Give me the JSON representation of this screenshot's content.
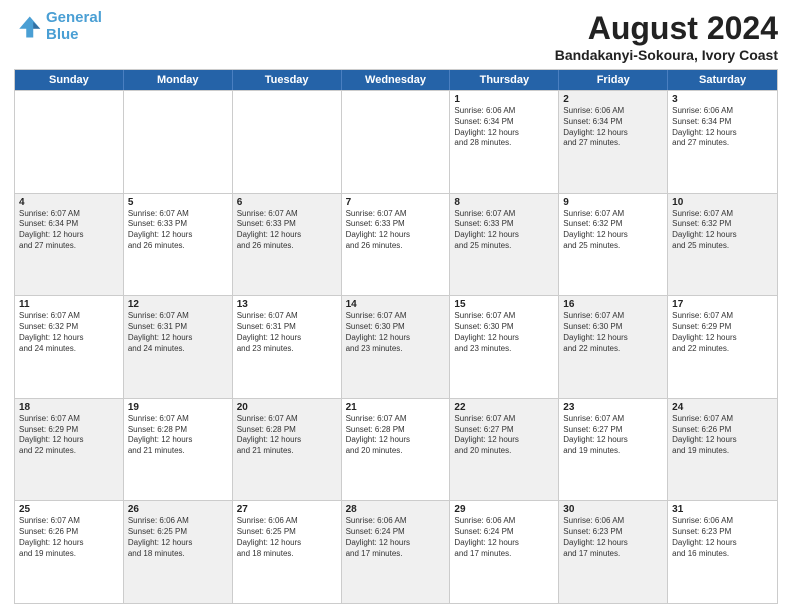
{
  "logo": {
    "line1": "General",
    "line2": "Blue"
  },
  "title": "August 2024",
  "subtitle": "Bandakanyi-Sokoura, Ivory Coast",
  "header_days": [
    "Sunday",
    "Monday",
    "Tuesday",
    "Wednesday",
    "Thursday",
    "Friday",
    "Saturday"
  ],
  "weeks": [
    [
      {
        "day": "",
        "info": "",
        "shaded": false,
        "empty": true
      },
      {
        "day": "",
        "info": "",
        "shaded": false,
        "empty": true
      },
      {
        "day": "",
        "info": "",
        "shaded": false,
        "empty": true
      },
      {
        "day": "",
        "info": "",
        "shaded": false,
        "empty": true
      },
      {
        "day": "1",
        "info": "Sunrise: 6:06 AM\nSunset: 6:34 PM\nDaylight: 12 hours\nand 28 minutes.",
        "shaded": false
      },
      {
        "day": "2",
        "info": "Sunrise: 6:06 AM\nSunset: 6:34 PM\nDaylight: 12 hours\nand 27 minutes.",
        "shaded": true
      },
      {
        "day": "3",
        "info": "Sunrise: 6:06 AM\nSunset: 6:34 PM\nDaylight: 12 hours\nand 27 minutes.",
        "shaded": false
      }
    ],
    [
      {
        "day": "4",
        "info": "Sunrise: 6:07 AM\nSunset: 6:34 PM\nDaylight: 12 hours\nand 27 minutes.",
        "shaded": true
      },
      {
        "day": "5",
        "info": "Sunrise: 6:07 AM\nSunset: 6:33 PM\nDaylight: 12 hours\nand 26 minutes.",
        "shaded": false
      },
      {
        "day": "6",
        "info": "Sunrise: 6:07 AM\nSunset: 6:33 PM\nDaylight: 12 hours\nand 26 minutes.",
        "shaded": true
      },
      {
        "day": "7",
        "info": "Sunrise: 6:07 AM\nSunset: 6:33 PM\nDaylight: 12 hours\nand 26 minutes.",
        "shaded": false
      },
      {
        "day": "8",
        "info": "Sunrise: 6:07 AM\nSunset: 6:33 PM\nDaylight: 12 hours\nand 25 minutes.",
        "shaded": true
      },
      {
        "day": "9",
        "info": "Sunrise: 6:07 AM\nSunset: 6:32 PM\nDaylight: 12 hours\nand 25 minutes.",
        "shaded": false
      },
      {
        "day": "10",
        "info": "Sunrise: 6:07 AM\nSunset: 6:32 PM\nDaylight: 12 hours\nand 25 minutes.",
        "shaded": true
      }
    ],
    [
      {
        "day": "11",
        "info": "Sunrise: 6:07 AM\nSunset: 6:32 PM\nDaylight: 12 hours\nand 24 minutes.",
        "shaded": false
      },
      {
        "day": "12",
        "info": "Sunrise: 6:07 AM\nSunset: 6:31 PM\nDaylight: 12 hours\nand 24 minutes.",
        "shaded": true
      },
      {
        "day": "13",
        "info": "Sunrise: 6:07 AM\nSunset: 6:31 PM\nDaylight: 12 hours\nand 23 minutes.",
        "shaded": false
      },
      {
        "day": "14",
        "info": "Sunrise: 6:07 AM\nSunset: 6:30 PM\nDaylight: 12 hours\nand 23 minutes.",
        "shaded": true
      },
      {
        "day": "15",
        "info": "Sunrise: 6:07 AM\nSunset: 6:30 PM\nDaylight: 12 hours\nand 23 minutes.",
        "shaded": false
      },
      {
        "day": "16",
        "info": "Sunrise: 6:07 AM\nSunset: 6:30 PM\nDaylight: 12 hours\nand 22 minutes.",
        "shaded": true
      },
      {
        "day": "17",
        "info": "Sunrise: 6:07 AM\nSunset: 6:29 PM\nDaylight: 12 hours\nand 22 minutes.",
        "shaded": false
      }
    ],
    [
      {
        "day": "18",
        "info": "Sunrise: 6:07 AM\nSunset: 6:29 PM\nDaylight: 12 hours\nand 22 minutes.",
        "shaded": true
      },
      {
        "day": "19",
        "info": "Sunrise: 6:07 AM\nSunset: 6:28 PM\nDaylight: 12 hours\nand 21 minutes.",
        "shaded": false
      },
      {
        "day": "20",
        "info": "Sunrise: 6:07 AM\nSunset: 6:28 PM\nDaylight: 12 hours\nand 21 minutes.",
        "shaded": true
      },
      {
        "day": "21",
        "info": "Sunrise: 6:07 AM\nSunset: 6:28 PM\nDaylight: 12 hours\nand 20 minutes.",
        "shaded": false
      },
      {
        "day": "22",
        "info": "Sunrise: 6:07 AM\nSunset: 6:27 PM\nDaylight: 12 hours\nand 20 minutes.",
        "shaded": true
      },
      {
        "day": "23",
        "info": "Sunrise: 6:07 AM\nSunset: 6:27 PM\nDaylight: 12 hours\nand 19 minutes.",
        "shaded": false
      },
      {
        "day": "24",
        "info": "Sunrise: 6:07 AM\nSunset: 6:26 PM\nDaylight: 12 hours\nand 19 minutes.",
        "shaded": true
      }
    ],
    [
      {
        "day": "25",
        "info": "Sunrise: 6:07 AM\nSunset: 6:26 PM\nDaylight: 12 hours\nand 19 minutes.",
        "shaded": false
      },
      {
        "day": "26",
        "info": "Sunrise: 6:06 AM\nSunset: 6:25 PM\nDaylight: 12 hours\nand 18 minutes.",
        "shaded": true
      },
      {
        "day": "27",
        "info": "Sunrise: 6:06 AM\nSunset: 6:25 PM\nDaylight: 12 hours\nand 18 minutes.",
        "shaded": false
      },
      {
        "day": "28",
        "info": "Sunrise: 6:06 AM\nSunset: 6:24 PM\nDaylight: 12 hours\nand 17 minutes.",
        "shaded": true
      },
      {
        "day": "29",
        "info": "Sunrise: 6:06 AM\nSunset: 6:24 PM\nDaylight: 12 hours\nand 17 minutes.",
        "shaded": false
      },
      {
        "day": "30",
        "info": "Sunrise: 6:06 AM\nSunset: 6:23 PM\nDaylight: 12 hours\nand 17 minutes.",
        "shaded": true
      },
      {
        "day": "31",
        "info": "Sunrise: 6:06 AM\nSunset: 6:23 PM\nDaylight: 12 hours\nand 16 minutes.",
        "shaded": false
      }
    ]
  ]
}
